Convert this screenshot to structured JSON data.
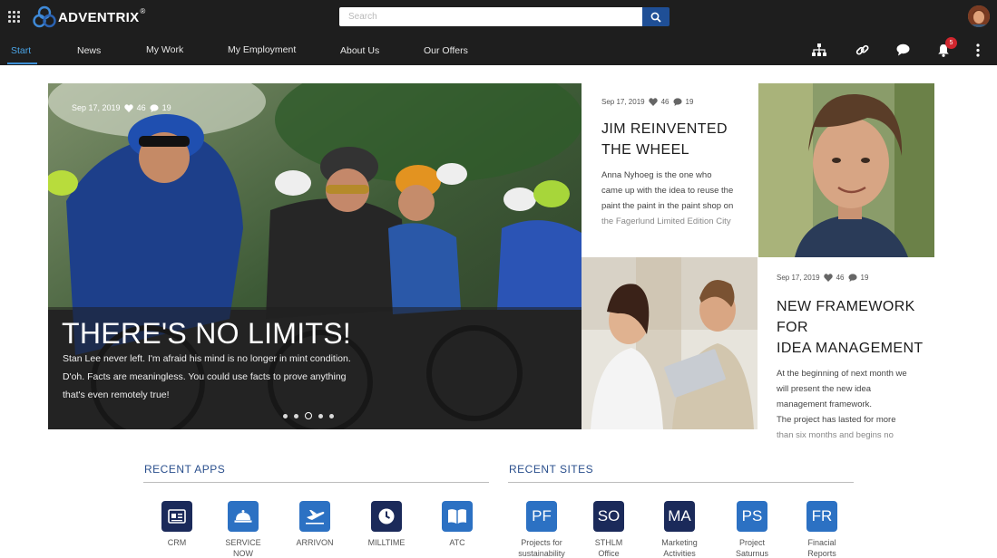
{
  "brand": {
    "name": "ADVENTRIX",
    "reg": "®"
  },
  "search": {
    "placeholder": "Search"
  },
  "nav": [
    "Start",
    "News",
    "My Work",
    "My Employment",
    "About Us",
    "Our Offers"
  ],
  "notifications": {
    "count": "5"
  },
  "colors": {
    "topbar": "#1e1e1e",
    "accent": "#3d8fd6",
    "brand_blue": "#1f4f96",
    "app_navy": "#1b2a5a",
    "app_blue": "#2c71c3",
    "badge": "#d0262e"
  },
  "hero": {
    "date": "Sep 17, 2019",
    "likes": "46",
    "comments": "19",
    "title": "THERE'S NO LIMITS!",
    "lines": [
      "Stan Lee never left. I'm afraid his mind is no longer in mint condition.",
      "D'oh. Facts are meaningless. You could use facts to prove anything",
      "that's even remotely true!"
    ],
    "dots": 5,
    "active_dot": 3
  },
  "article1": {
    "date": "Sep 17, 2019",
    "likes": "46",
    "comments": "19",
    "title_lines": [
      "JIM REINVENTED",
      "THE WHEEL"
    ],
    "lines": [
      "Anna Nyhoeg is the one who",
      "came up with the idea to reuse the",
      "paint the paint in the paint shop on",
      "the Fagerlund Limited Edition City"
    ]
  },
  "article2": {
    "date": "Sep 17, 2019",
    "likes": "46",
    "comments": "19",
    "title_lines": [
      "NEW FRAMEWORK FOR",
      "IDEA MANAGEMENT"
    ],
    "lines": [
      "At the beginning of next month we",
      "will present the new idea",
      "management framework.",
      "The project has lasted for more",
      "than six months and begins no"
    ]
  },
  "recent_apps": {
    "title": "RECENT APPS",
    "items": [
      {
        "label": "CRM",
        "icon": "id-card-icon"
      },
      {
        "label": "SERVICE NOW",
        "icon": "service-bell-icon"
      },
      {
        "label": "ARRIVON",
        "icon": "airplane-icon"
      },
      {
        "label": "MILLTIME",
        "icon": "clock-icon"
      },
      {
        "label": "ATC",
        "icon": "open-book-icon"
      }
    ]
  },
  "recent_sites": {
    "title": "RECENT SITES",
    "items": [
      {
        "abbr": "PF",
        "label": "Projects for sustainability"
      },
      {
        "abbr": "SO",
        "label": "STHLM Office"
      },
      {
        "abbr": "MA",
        "label": "Marketing Activities"
      },
      {
        "abbr": "PS",
        "label": "Project Saturnus"
      },
      {
        "abbr": "FR",
        "label": "Finacial Reports"
      }
    ]
  }
}
